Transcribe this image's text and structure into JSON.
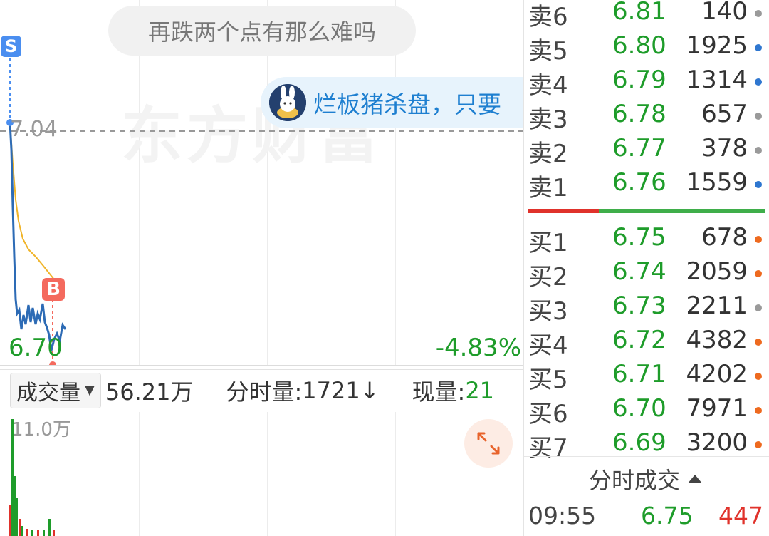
{
  "chart": {
    "comment_pill": "再跌两个点有那么难吗",
    "bullet_comment": "烂板猪杀盘，只要",
    "watermark": "东方财富",
    "ref_price": "7.04",
    "low_price": "6.70",
    "change_pct": "-4.83%",
    "sell_marker": "S",
    "buy_marker": "B",
    "colors": {
      "up": "#e0322b",
      "down": "#1e9c2a",
      "avg_line": "#f0b429",
      "price_line": "#2d6bb5"
    }
  },
  "volume_bar": {
    "indicator": "成交量",
    "total": "56.21万",
    "period_vol_label": "分时量:",
    "period_vol_value": "1721",
    "period_vol_trend_icon": "↓",
    "current_label": "现量:",
    "current_value": "21",
    "max_label": "11.0万"
  },
  "order_book": {
    "asks": [
      {
        "label": "卖6",
        "price": "6.81",
        "qty": "140",
        "dot": "gray"
      },
      {
        "label": "卖5",
        "price": "6.80",
        "qty": "1925",
        "dot": "blue"
      },
      {
        "label": "卖4",
        "price": "6.79",
        "qty": "1314",
        "dot": "blue"
      },
      {
        "label": "卖3",
        "price": "6.78",
        "qty": "657",
        "dot": "gray"
      },
      {
        "label": "卖2",
        "price": "6.77",
        "qty": "378",
        "dot": "gray"
      },
      {
        "label": "卖1",
        "price": "6.76",
        "qty": "1559",
        "dot": "blue"
      }
    ],
    "bids": [
      {
        "label": "买1",
        "price": "6.75",
        "qty": "678",
        "dot": "orange"
      },
      {
        "label": "买2",
        "price": "6.74",
        "qty": "2059",
        "dot": "orange"
      },
      {
        "label": "买3",
        "price": "6.73",
        "qty": "2211",
        "dot": "gray"
      },
      {
        "label": "买4",
        "price": "6.72",
        "qty": "4382",
        "dot": "orange"
      },
      {
        "label": "买5",
        "price": "6.71",
        "qty": "4202",
        "dot": "orange"
      },
      {
        "label": "买6",
        "price": "6.70",
        "qty": "7971",
        "dot": "orange"
      },
      {
        "label": "买7",
        "price": "6.69",
        "qty": "3200",
        "dot": "orange"
      }
    ],
    "ticks_header": "分时成交",
    "ticks_header_icon": "triangle-up-icon",
    "ticks": [
      {
        "time": "09:55",
        "price": "6.75",
        "volume": "447"
      }
    ]
  }
}
